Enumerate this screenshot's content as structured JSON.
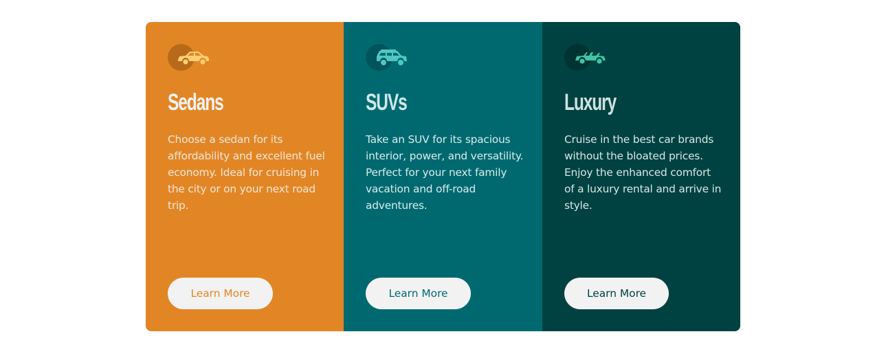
{
  "cards": [
    {
      "title": "Sedans",
      "description": "Choose a sedan for its affordability and excellent fuel economy. Ideal for cruising in the city or on your next road trip.",
      "button_label": "Learn More",
      "icon": "sedan-car-icon",
      "colors": {
        "background": "#e28625",
        "circle": "#b86a1a",
        "icon": "#ffcf73",
        "title": "#f2f2f2",
        "text": "#f2e6d9",
        "button_text": "#e28625"
      }
    },
    {
      "title": "SUVs",
      "description": "Take an SUV for its spacious interior, power, and versatility. Perfect for your next family vacation and off-road adventures.",
      "button_label": "Learn More",
      "icon": "suv-car-icon",
      "colors": {
        "background": "#006970",
        "circle": "#00545a",
        "icon": "#4fc7c0",
        "title": "#cfe8e8",
        "text": "#d8ecec",
        "button_text": "#006970"
      }
    },
    {
      "title": "Luxury",
      "description": "Cruise in the best car brands without the bloated prices. Enjoy the enhanced comfort of a luxury rental and arrive in style.",
      "button_label": "Learn More",
      "icon": "convertible-car-icon",
      "colors": {
        "background": "#004241",
        "circle": "#003433",
        "icon": "#3ec5a4",
        "title": "#cfe0e0",
        "text": "#d8e6e6",
        "button_text": "#004241"
      }
    }
  ]
}
